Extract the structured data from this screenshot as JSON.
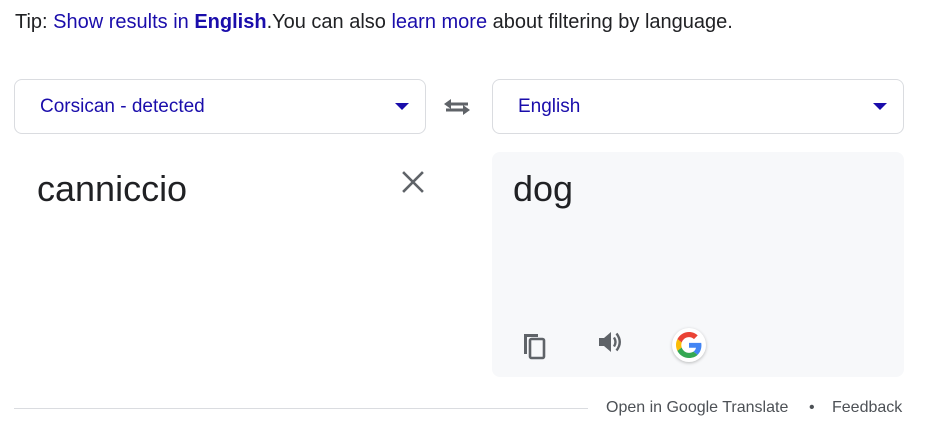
{
  "tip": {
    "prefix": "Tip: ",
    "show_results_text": "Show results in ",
    "show_results_lang": "English",
    "middle": ".You can also ",
    "learn_more": "learn more",
    "suffix": " about filtering by language."
  },
  "source": {
    "language": "Corsican - detected",
    "text": "canniccio"
  },
  "target": {
    "language": "English",
    "text": "dog"
  },
  "footer": {
    "open_link": "Open in Google Translate",
    "separator": "•",
    "feedback": "Feedback"
  },
  "colors": {
    "link": "#1a0dab",
    "text": "#202124",
    "muted": "#4d5156",
    "border": "#dadce0",
    "result_bg": "#f7f8fa",
    "icon": "#5f6368"
  },
  "icons": {
    "swap": "swap-arrows-icon",
    "clear": "close-icon",
    "copy": "copy-icon",
    "speak": "speaker-icon",
    "google": "google-logo-icon"
  }
}
